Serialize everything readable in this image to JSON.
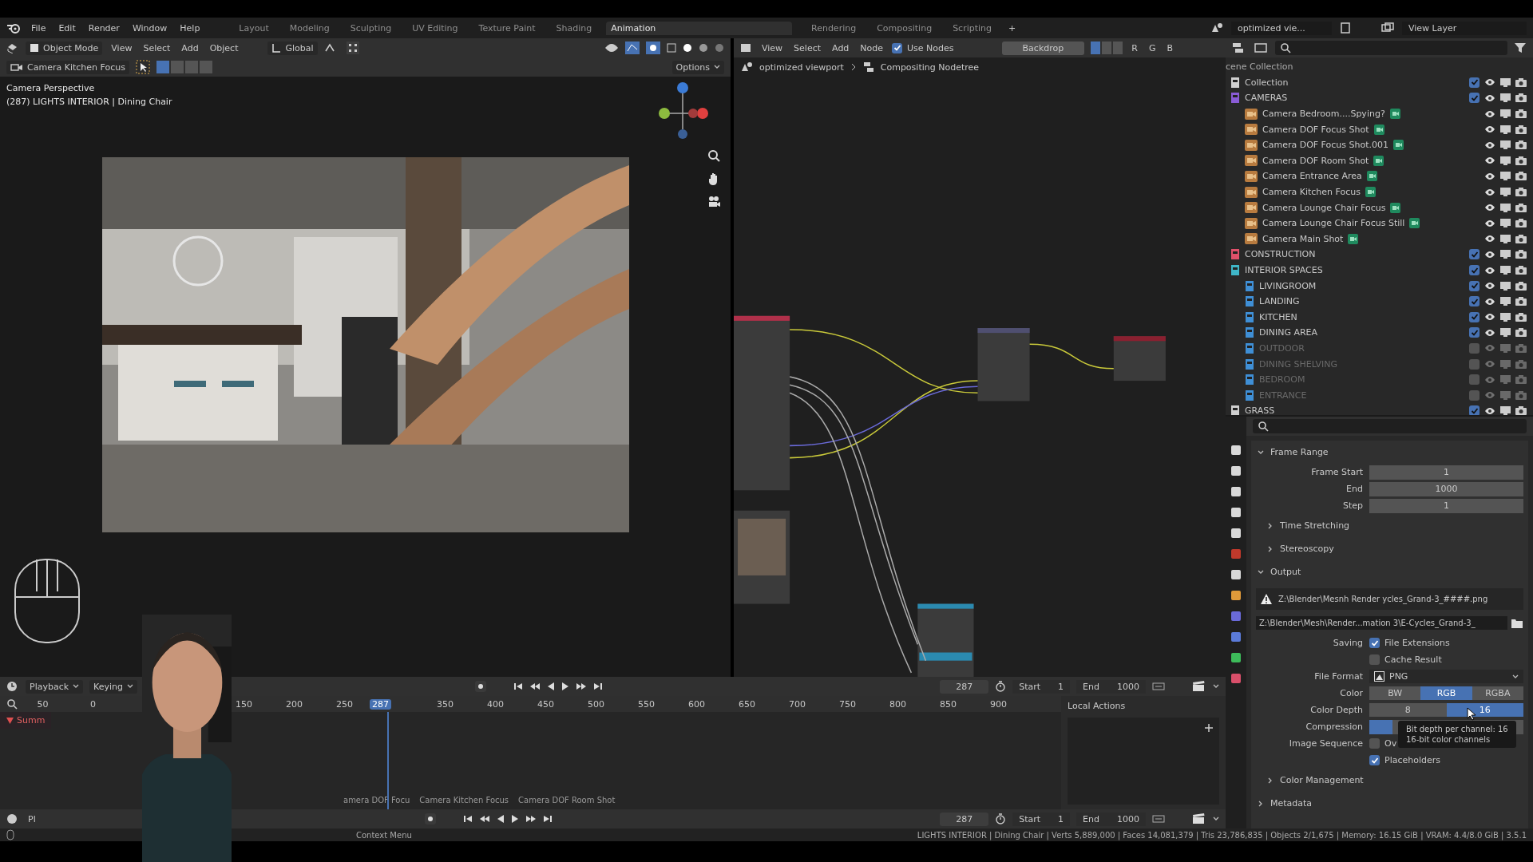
{
  "topbar": {
    "menus": [
      "File",
      "Edit",
      "Render",
      "Window",
      "Help"
    ],
    "workspaces": [
      {
        "label": "Layout",
        "selected": false
      },
      {
        "label": "Modeling",
        "selected": false
      },
      {
        "label": "Sculpting",
        "selected": false
      },
      {
        "label": "UV Editing",
        "selected": false
      },
      {
        "label": "Texture Paint",
        "selected": false
      },
      {
        "label": "Shading",
        "selected": false
      },
      {
        "label": "Animation",
        "selected": true
      },
      {
        "label": "Rendering",
        "selected": false
      },
      {
        "label": "Compositing",
        "selected": false
      },
      {
        "label": "Scripting",
        "selected": false
      }
    ],
    "add_tab": "+",
    "scene": "optimized vie...",
    "view_layer": "View Layer"
  },
  "viewport": {
    "mode": "Object Mode",
    "menus": [
      "View",
      "Select",
      "Add",
      "Object"
    ],
    "orientation": "Global",
    "camera": "Camera Kitchen Focus",
    "options": "Options",
    "overlay_lines": [
      "Camera Perspective",
      "(287) LIGHTS INTERIOR | Dining Chair"
    ],
    "render": {
      "kind": "picture"
    }
  },
  "node_editor": {
    "menus": [
      "View",
      "Select",
      "Add",
      "Node"
    ],
    "use_nodes": {
      "label": "Use Nodes",
      "checked": true
    },
    "backdrop": "Backdrop",
    "channels": [
      "R",
      "G",
      "B"
    ],
    "breadcrumbs": [
      "optimized viewport",
      "Compositing Nodetree"
    ]
  },
  "outliner": {
    "root": "cene Collection",
    "items": [
      {
        "kind": "collection",
        "name": "Collection",
        "color": "#d0d0d0",
        "checked": true
      },
      {
        "kind": "collection",
        "name": "CAMERAS",
        "color": "#8a5cd6",
        "checked": true,
        "children": [
          {
            "kind": "camera",
            "name": "Camera Bedroom....Spying?"
          },
          {
            "kind": "camera",
            "name": "Camera DOF Focus Shot"
          },
          {
            "kind": "camera",
            "name": "Camera DOF Focus Shot.001"
          },
          {
            "kind": "camera",
            "name": "Camera DOF Room Shot"
          },
          {
            "kind": "camera",
            "name": "Camera Entrance Area"
          },
          {
            "kind": "camera",
            "name": "Camera Kitchen Focus"
          },
          {
            "kind": "camera",
            "name": "Camera Lounge Chair Focus"
          },
          {
            "kind": "camera",
            "name": "Camera Lounge Chair Focus Still"
          },
          {
            "kind": "camera",
            "name": "Camera Main Shot"
          }
        ]
      },
      {
        "kind": "collection",
        "name": "CONSTRUCTION",
        "color": "#e0506a",
        "checked": true
      },
      {
        "kind": "collection",
        "name": "INTERIOR SPACES",
        "color": "#3fb6c8",
        "checked": true,
        "children": [
          {
            "kind": "collection",
            "name": "LIVINGROOM",
            "color": "#3f8fd6",
            "checked": true
          },
          {
            "kind": "collection",
            "name": "LANDING",
            "color": "#3f8fd6",
            "checked": true
          },
          {
            "kind": "collection",
            "name": "KITCHEN",
            "color": "#3f8fd6",
            "checked": true
          },
          {
            "kind": "collection",
            "name": "DINING AREA",
            "color": "#3f8fd6",
            "checked": true
          },
          {
            "kind": "collection",
            "name": "OUTDOOR",
            "color": "#3f8fd6",
            "checked": false
          },
          {
            "kind": "collection",
            "name": "DINING SHELVING",
            "color": "#3f8fd6",
            "checked": false
          },
          {
            "kind": "collection",
            "name": "BEDROOM",
            "color": "#3f8fd6",
            "checked": false
          },
          {
            "kind": "collection",
            "name": "ENTRANCE",
            "color": "#3f8fd6",
            "checked": false
          }
        ]
      },
      {
        "kind": "collection",
        "name": "GRASS",
        "color": "#d0d0d0",
        "checked": true
      }
    ]
  },
  "properties": {
    "frame_range": {
      "title": "Frame Range",
      "expanded": true,
      "fields": [
        {
          "label": "Frame Start",
          "value": "1"
        },
        {
          "label": "End",
          "value": "1000"
        },
        {
          "label": "Step",
          "value": "1"
        }
      ]
    },
    "subpanels": [
      {
        "title": "Time Stretching",
        "expanded": false
      },
      {
        "title": "Stereoscopy",
        "expanded": false
      }
    ],
    "output": {
      "title": "Output",
      "expanded": true,
      "warning": "Z:\\Blender\\Mesnh Render  ycles_Grand-3_####.png",
      "path": "Z:\\Blender\\Mesh\\Render...mation 3\\E-Cycles_Grand-3_",
      "saving_label": "Saving",
      "saving": [
        {
          "label": "File Extensions",
          "checked": true
        },
        {
          "label": "Cache Result",
          "checked": false
        }
      ],
      "file_format_label": "File Format",
      "file_format": "PNG",
      "color_label": "Color",
      "color_options": [
        {
          "label": "BW",
          "selected": false
        },
        {
          "label": "RGB",
          "selected": true
        },
        {
          "label": "RGBA",
          "selected": false
        }
      ],
      "depth_label": "Color Depth",
      "depth_options": [
        {
          "label": "8",
          "selected": false
        },
        {
          "label": "16",
          "selected": true
        }
      ],
      "compression_label": "Compression",
      "compression": {
        "level": 0.15
      },
      "sequence_label": "Image Sequence",
      "sequence": [
        {
          "label": "Ov",
          "checked": false
        },
        {
          "label": "Placeholders",
          "checked": true
        }
      ]
    },
    "tooltip": [
      "Bit depth per channel:  16",
      "16-bit color channels"
    ],
    "collapsed": [
      {
        "title": "Color Management",
        "expanded": false
      },
      {
        "title": "Metadata",
        "expanded": false
      }
    ]
  },
  "timeline": {
    "menus": [
      "Playback",
      "Keying"
    ],
    "frame": "287",
    "start_label": "Start",
    "start": "1",
    "end_label": "End",
    "end": "1000",
    "ticks": [
      "50",
      "0",
      "150",
      "200",
      "250",
      "350",
      "400",
      "450",
      "500",
      "550",
      "600",
      "650",
      "700",
      "750",
      "800",
      "850",
      "900"
    ],
    "current": "287",
    "channel": "Summ",
    "markers": [
      "amera DOF Focu",
      "Camera Kitchen Focus",
      "Camera DOF Room Shot"
    ],
    "local_actions": "Local Actions"
  },
  "timeline2": {
    "menu": "Pl",
    "frame": "287",
    "start_label": "Start",
    "start": "1",
    "end_label": "End",
    "end": "1000"
  },
  "webcam": {
    "kind": "picture"
  },
  "status_bar": {
    "hint": "Context Menu",
    "info": "LIGHTS INTERIOR | Dining Chair | Verts 5,889,000 | Faces 14,081,379 | Tris 23,786,835 | Objects 2/1,675 | Memory: 16.15 GiB | VRAM: 4.4/8.0 GiB | 3.5.1"
  }
}
